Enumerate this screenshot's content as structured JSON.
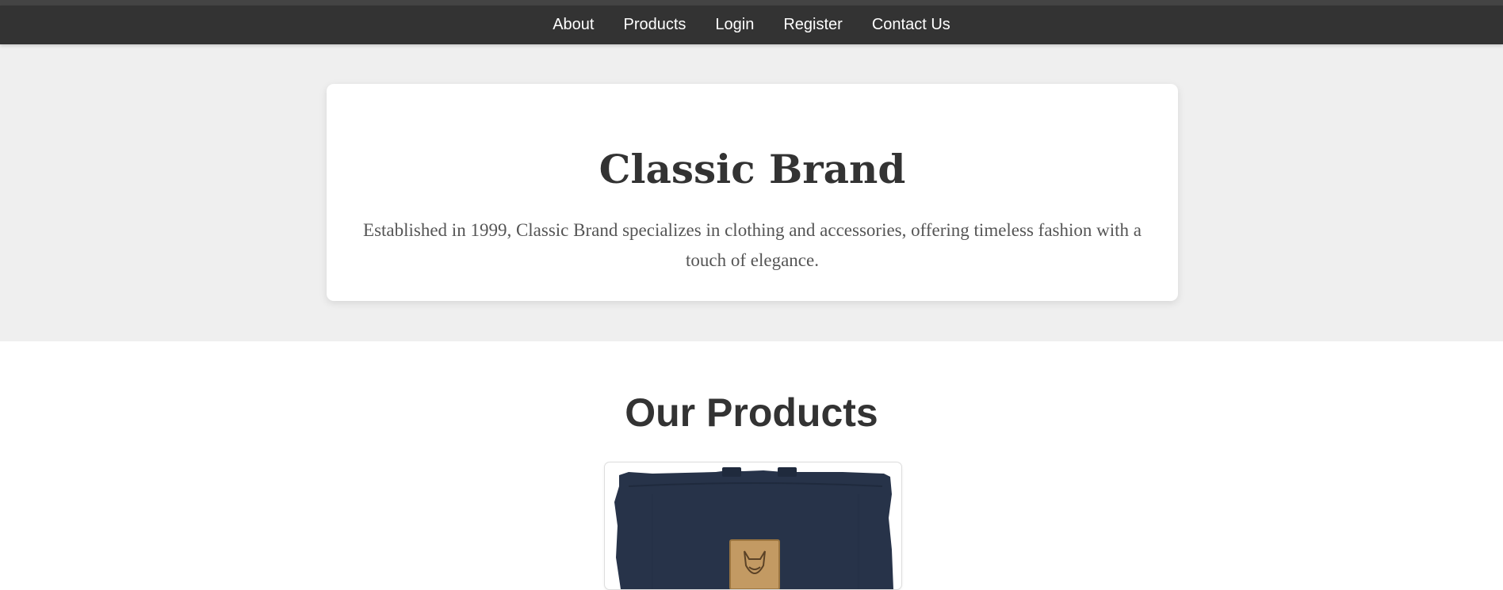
{
  "nav": {
    "items": [
      {
        "label": "About"
      },
      {
        "label": "Products"
      },
      {
        "label": "Login"
      },
      {
        "label": "Register"
      },
      {
        "label": "Contact Us"
      }
    ]
  },
  "hero": {
    "title": "Classic Brand",
    "description": "Established in 1999, Classic Brand specializes in clothing and accessories, offering timeless fashion with a touch of elegance."
  },
  "products": {
    "heading": "Our Products",
    "items": [
      {
        "image_icon": "navy-backpack-image"
      }
    ]
  },
  "colors": {
    "nav_bg": "#333333",
    "hero_bg": "#efefef",
    "text_dark": "#333333",
    "text_muted": "#555555",
    "bag_navy": "#273349",
    "patch_tan": "#c39a63"
  }
}
